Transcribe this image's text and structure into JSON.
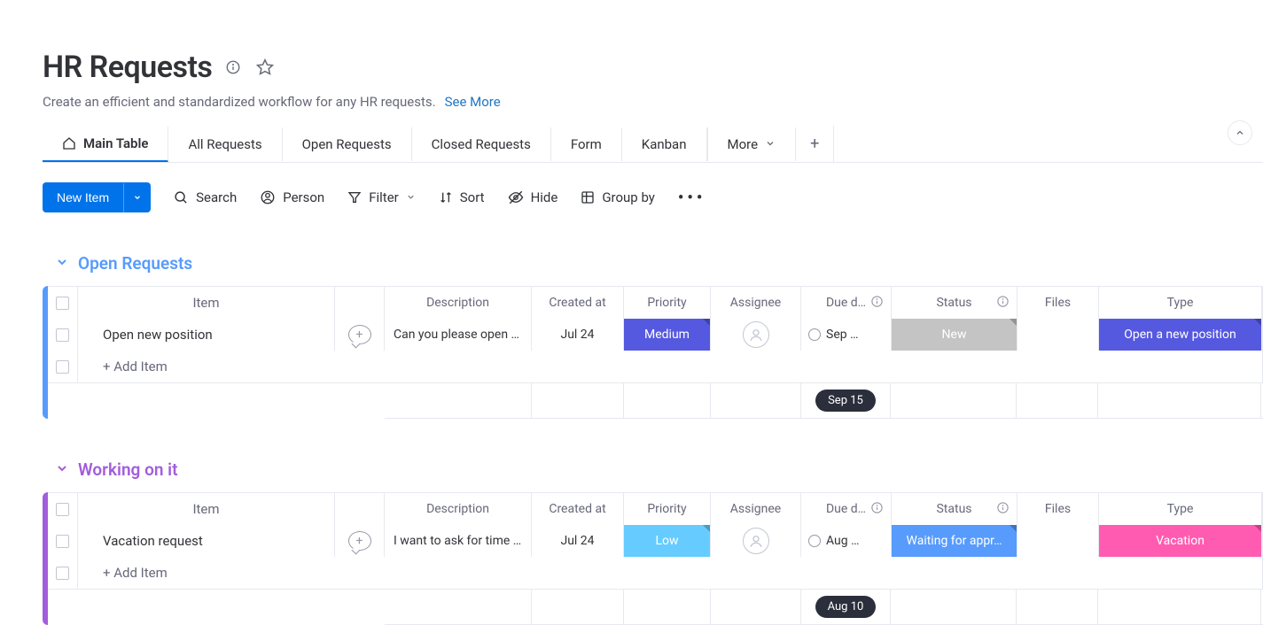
{
  "header": {
    "title": "HR Requests",
    "subtitle": "Create an efficient and standardized workflow for any HR requests.",
    "see_more": "See More"
  },
  "tabs": {
    "main": "Main Table",
    "all": "All Requests",
    "open": "Open Requests",
    "closed": "Closed Requests",
    "form": "Form",
    "kanban": "Kanban",
    "more": "More"
  },
  "toolbar": {
    "new_item": "New Item",
    "search": "Search",
    "person": "Person",
    "filter": "Filter",
    "sort": "Sort",
    "hide": "Hide",
    "group_by": "Group by"
  },
  "columns": {
    "item": "Item",
    "description": "Description",
    "created_at": "Created at",
    "priority": "Priority",
    "assignee": "Assignee",
    "due": "Due d…",
    "status": "Status",
    "files": "Files",
    "type": "Type"
  },
  "add_item": "+ Add Item",
  "groups": [
    {
      "title": "Open Requests",
      "color": "#579bfc",
      "rows": [
        {
          "item": "Open new position",
          "description": "Can you please open a…",
          "created_at": "Jul 24",
          "priority": {
            "label": "Medium",
            "color": "#5559df"
          },
          "due": "Sep …",
          "status": {
            "label": "New",
            "color": "#c4c4c4"
          },
          "type": {
            "label": "Open a new position",
            "color": "#5559df"
          }
        }
      ],
      "footer_date": "Sep 15"
    },
    {
      "title": "Working on it",
      "color": "#a25ddc",
      "rows": [
        {
          "item": "Vacation request",
          "description": "I want to ask for time …",
          "created_at": "Jul 24",
          "priority": {
            "label": "Low",
            "color": "#66ccff"
          },
          "due": "Aug …",
          "status": {
            "label": "Waiting for appr…",
            "color": "#579bfc"
          },
          "type": {
            "label": "Vacation",
            "color": "#ff5bb0"
          }
        }
      ],
      "footer_date": "Aug 10"
    }
  ]
}
